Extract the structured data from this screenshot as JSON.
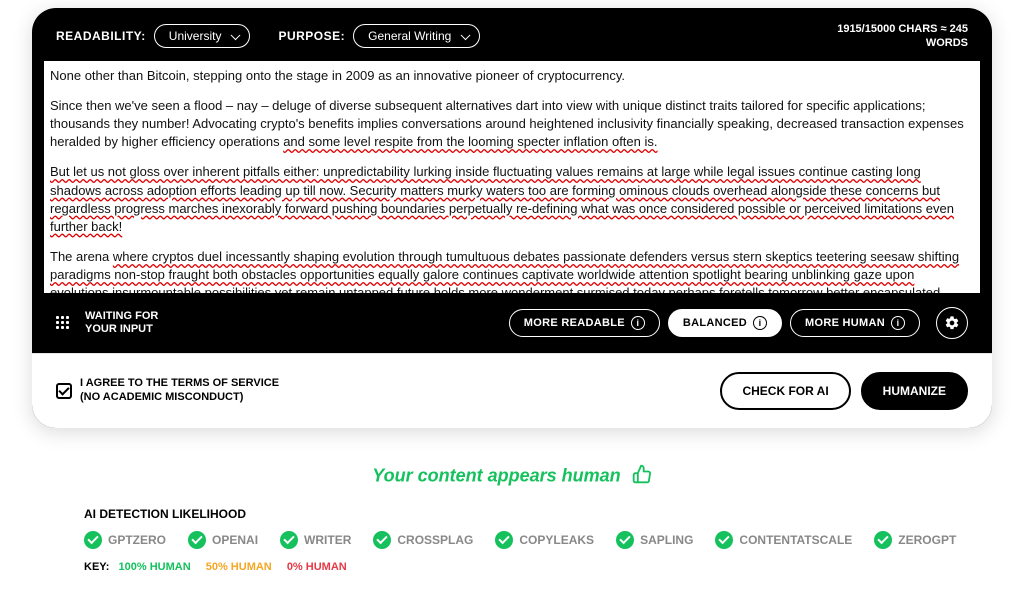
{
  "top": {
    "readability_label": "READABILITY:",
    "readability_value": "University",
    "purpose_label": "PURPOSE:",
    "purpose_value": "General Writing",
    "chars_line1": "1915/15000 CHARS ≈ 245",
    "chars_line2": "WORDS"
  },
  "content": {
    "p1": "None other than Bitcoin, stepping onto the stage in 2009 as an innovative pioneer of cryptocurrency.",
    "p2_a": "Since then we've seen a flood – nay – deluge of diverse subsequent alternatives dart into view with unique distinct traits tailored for specific applications; thousands they number! Advocating crypto's benefits implies conversations around heightened inclusivity financially speaking, decreased transaction expenses heralded by higher efficiency operations ",
    "p2_b": "and some level respite from the looming specter inflation often is.",
    "p3_a": "But let us not gloss over inherent pitfalls either: unpredictability lurking inside fluctuating values remains at large while legal issues continue casting long shadows across adoption efforts leading up till now. Security matters murky waters too are forming ominous clouds overhead alongside these concerns but regardless progress marches inexorably forward pushing boundaries perpetually re-defining what was once considered possible or perceived limitations even further back!",
    "p4_a": "The arena ",
    "p4_b": "where cryptos duel incessantly shaping evolution through tumultuous debates passionate defenders versus stern skeptics teetering seesaw shifting paradigms non-stop fraught both obstacles opportunities equally galore continues captivate worldwide attention spotlight bearing unblinking gaze upon evolutions insurmountable possibilities yet remain untapped future holds more wonderment surmised today perhaps foretells tomorrow better encapsulated sentence one finds oneself existing quite exciting times indeed!"
  },
  "toolbar": {
    "waiting_l1": "WAITING FOR",
    "waiting_l2": "YOUR INPUT",
    "more_readable": "MORE READABLE",
    "balanced": "BALANCED",
    "more_human": "MORE HUMAN"
  },
  "footer": {
    "tos_l1": "I AGREE TO THE TERMS OF SERVICE",
    "tos_l2": "(NO ACADEMIC MISCONDUCT)",
    "check_ai": "CHECK FOR AI",
    "humanize": "HUMANIZE"
  },
  "result": {
    "banner": "Your content appears human"
  },
  "likelihood": {
    "title": "AI DETECTION LIKELIHOOD",
    "detectors": [
      "GPTZERO",
      "OPENAI",
      "WRITER",
      "CROSSPLAG",
      "COPYLEAKS",
      "SAPLING",
      "CONTENTATSCALE",
      "ZEROGPT"
    ],
    "key_label": "KEY:",
    "key_100": "100% HUMAN",
    "key_50": "50% HUMAN",
    "key_0": "0% HUMAN"
  }
}
